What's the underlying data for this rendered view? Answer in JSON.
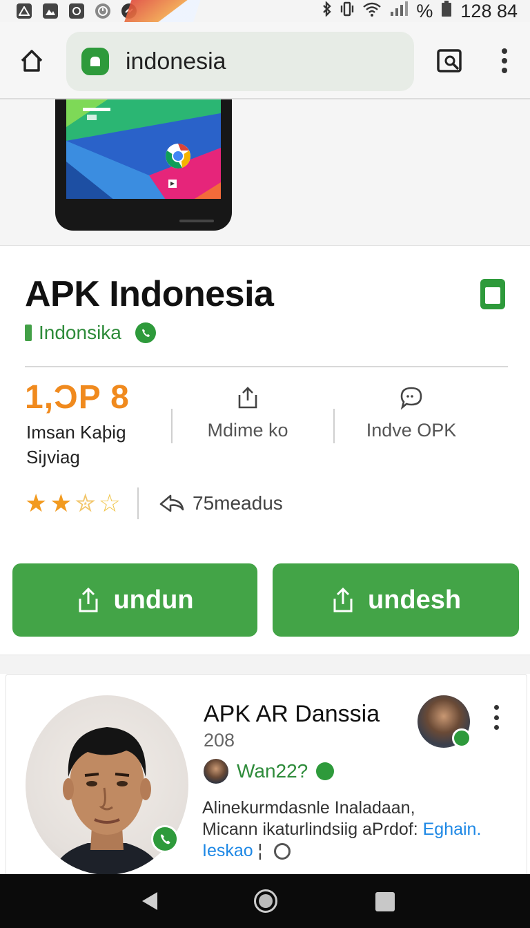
{
  "status_bar": {
    "time": "128 84",
    "battery_symbol": "%",
    "icons": [
      "warning-icon",
      "image-icon",
      "app-icon",
      "clock-icon",
      "messenger-icon",
      "bluetooth-icon",
      "vibrate-icon",
      "wifi-icon",
      "signal-icon",
      "battery-icon"
    ]
  },
  "browser": {
    "url": "indonesia",
    "icons": [
      "home-icon",
      "secure-site-icon",
      "tabs-icon",
      "overflow-menu-icon"
    ]
  },
  "app": {
    "title": "APK Indonesia",
    "developer": "Indonsika",
    "stat_value": "1,ϽP 8",
    "stat_label": "Imsan Kaþig Siյviag",
    "col2_label": "Mdime ko",
    "col3_label": "Indve OPK",
    "rating_stars": 2.5,
    "reviews": "75meadus",
    "buttons": {
      "left": "undun",
      "right": "undesh"
    },
    "accent_color": "#43a447",
    "stat_color": "#f08a1e"
  },
  "card": {
    "title": "APK AR Danssia",
    "count": "208",
    "author": "Wan22?",
    "desc_line1": "Alinekurmdasnle Inaladaan,",
    "desc_line2_text": "Micann ikaturlindsiig aPɾdof:",
    "desc_line2_link": "Eghain.",
    "desc_line3_link": "Ieskao",
    "desc_line3_text": "¦",
    "link_color": "#1e88e5"
  },
  "nav": {
    "icons": [
      "back-icon",
      "home-circle-icon",
      "recents-icon"
    ]
  }
}
